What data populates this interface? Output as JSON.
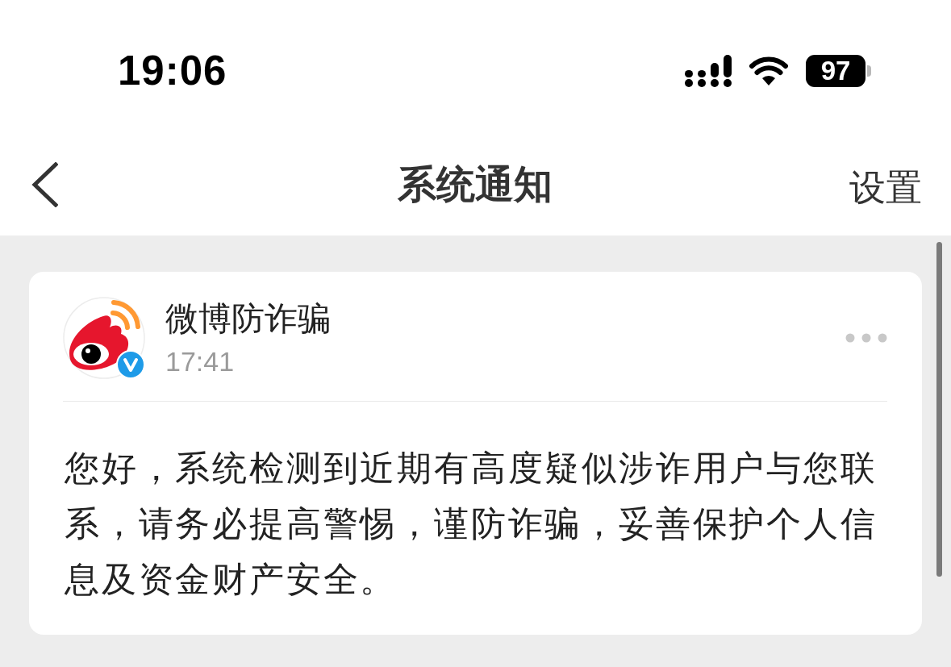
{
  "status_bar": {
    "time": "19:06",
    "battery": "97"
  },
  "nav_bar": {
    "title": "系统通知",
    "action": "设置"
  },
  "notification": {
    "sender": "微博防诈骗",
    "verified": true,
    "time": "17:41",
    "message": "您好，系统检测到近期有高度疑似涉诈用户与您联系，请务必提高警惕，谨防诈骗，妥善保护个人信息及资金财产安全。"
  }
}
